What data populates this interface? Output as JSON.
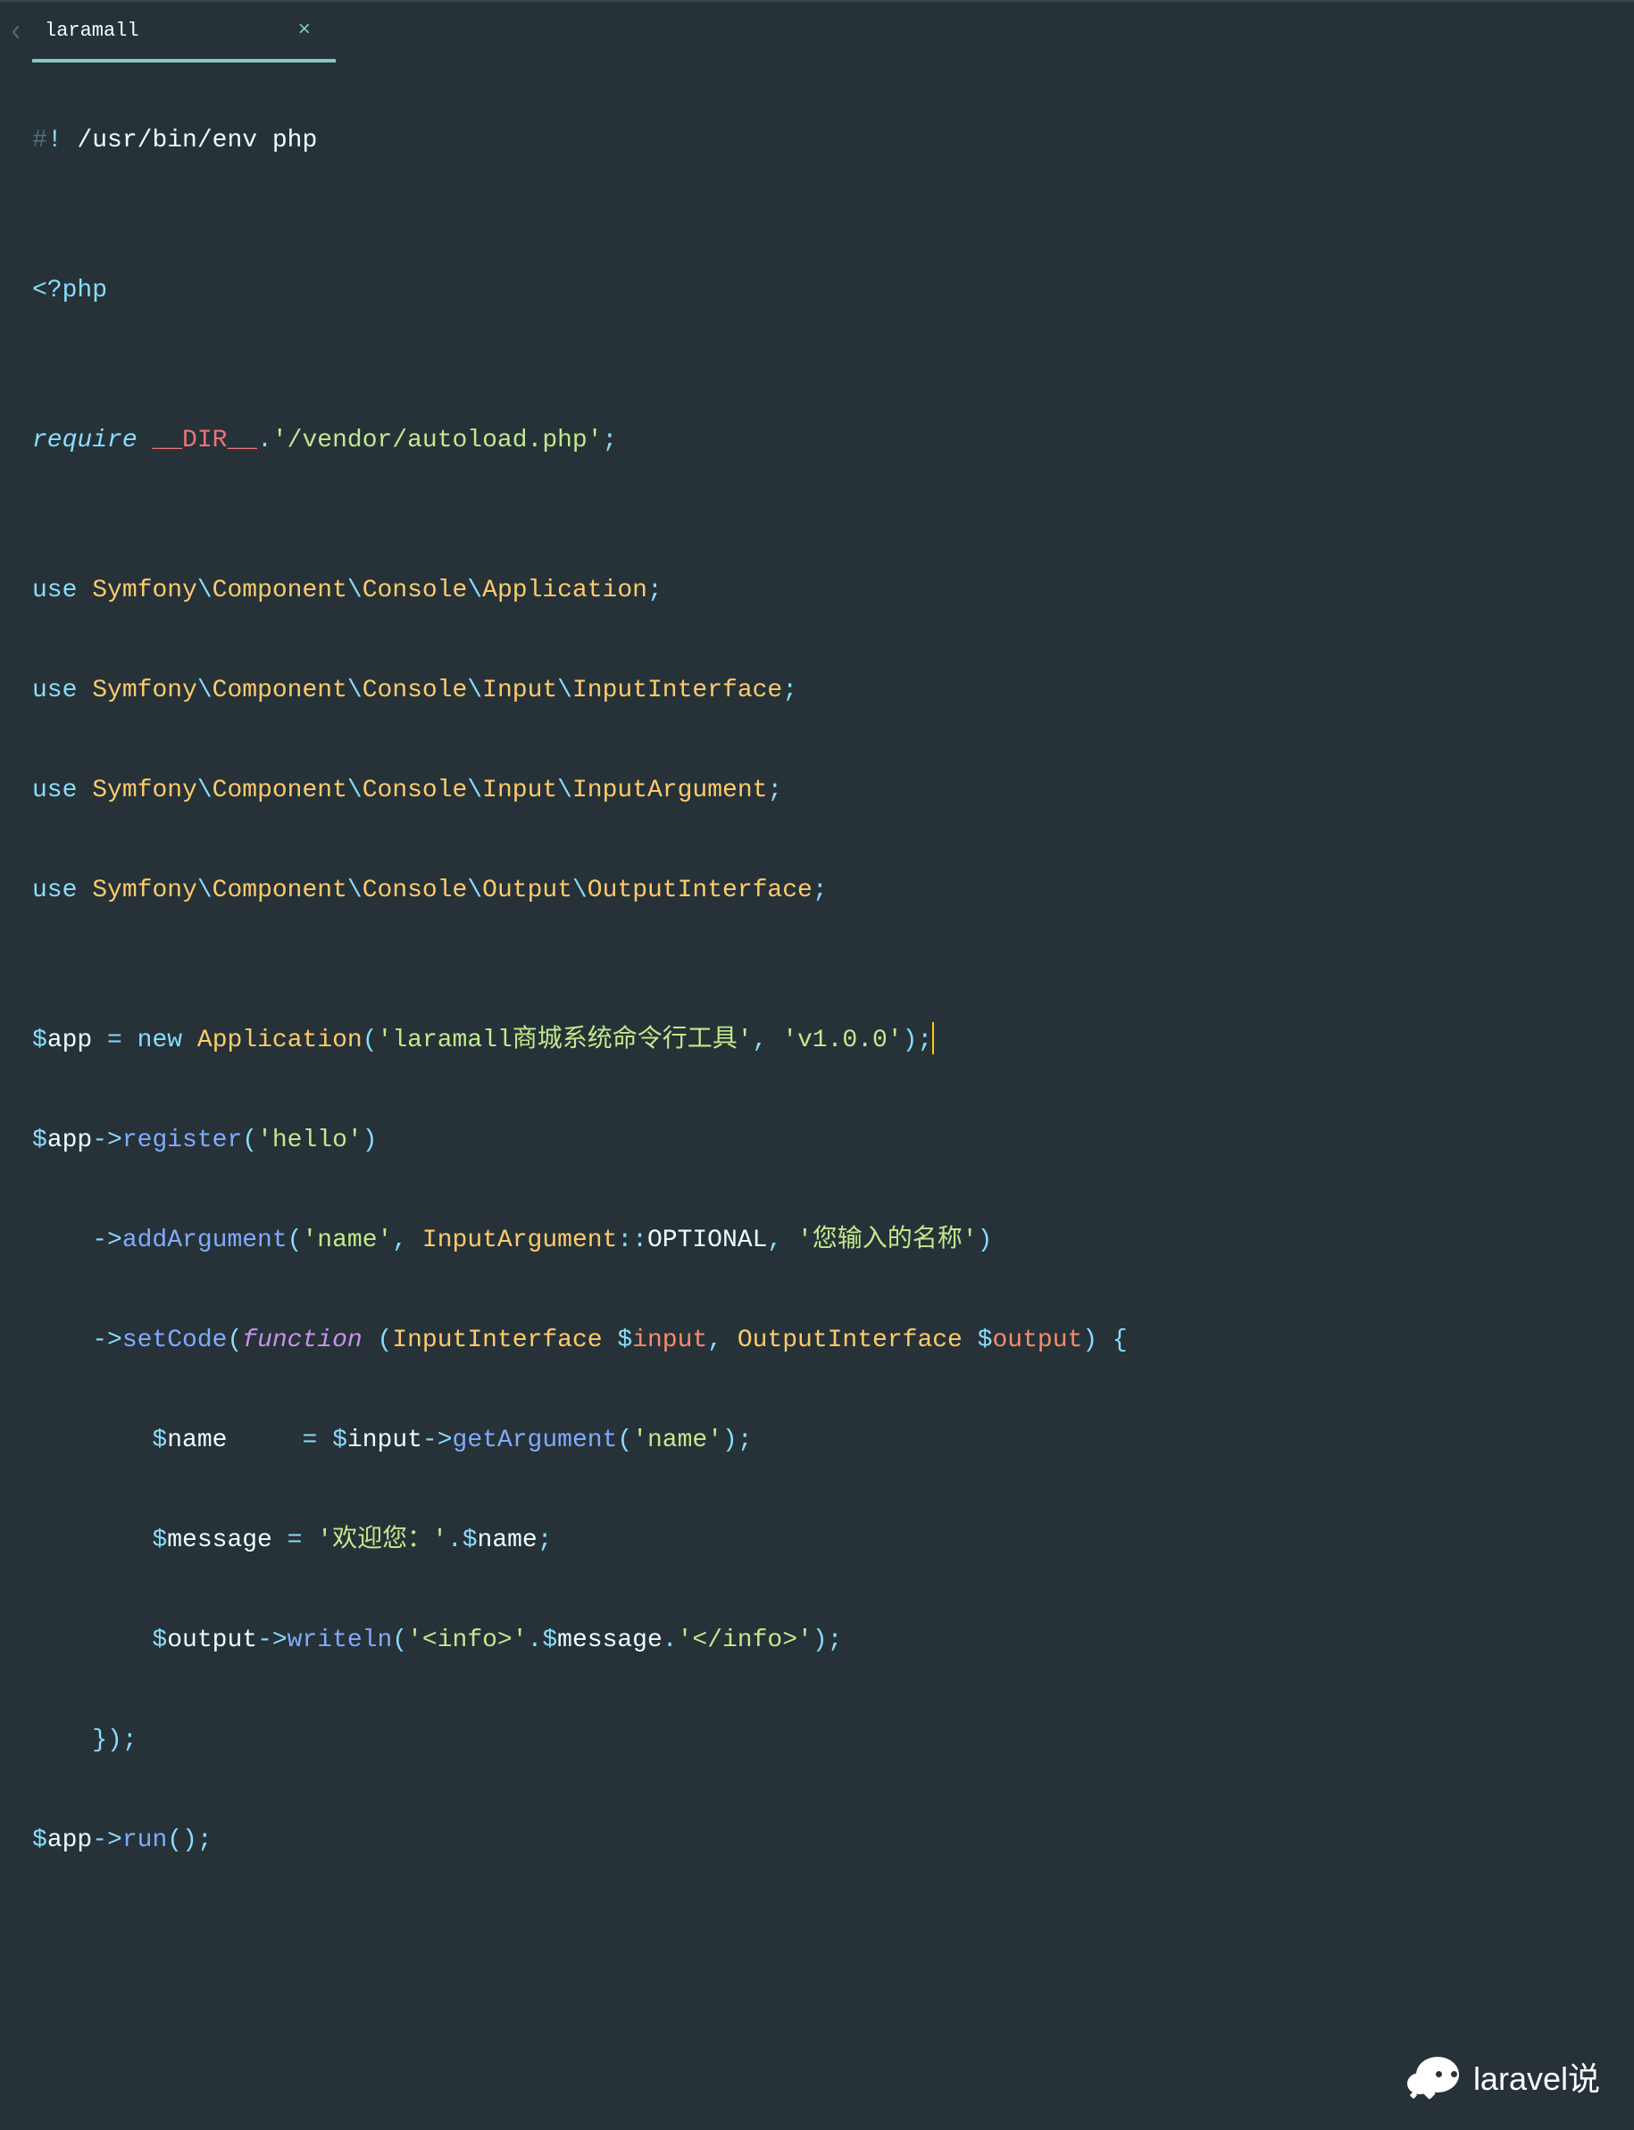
{
  "tab": {
    "label": "laramall",
    "close_glyph": "×"
  },
  "code": {
    "l1_shebang_prefix": "#",
    "l1_shebang_bang": "!",
    "l1_shebang_path": " /usr/bin/env php",
    "l3_php_open_lt": "<?",
    "l3_php_open_kw": "php",
    "l5_require": "require",
    "l5_dir": "__DIR__",
    "l5_dot": ".",
    "l5_path": "'/vendor/autoload.php'",
    "l5_semi": ";",
    "use_kw": "use",
    "ns_sep": "\\",
    "ns_symfony": "Symfony",
    "ns_component": "Component",
    "ns_console": "Console",
    "ns_input": "Input",
    "ns_output": "Output",
    "cls_application": "Application",
    "cls_inputinterface": "InputInterface",
    "cls_inputargument": "InputArgument",
    "cls_outputinterface": "OutputInterface",
    "semi": ";",
    "dollar": "$",
    "var_app": "app",
    "eq": " = ",
    "new_kw": "new",
    "app_name_str": "'laramall商城系统命令行工具'",
    "comma": ", ",
    "app_ver_str": "'v1.0.0'",
    "lparen": "(",
    "rparen": ")",
    "arrow": "->",
    "m_register": "register",
    "hello_str": "'hello'",
    "m_addargument": "addArgument",
    "name_str": "'name'",
    "scope": "::",
    "const_optional": "OPTIONAL",
    "desc_str": "'您输入的名称'",
    "m_setcode": "setCode",
    "function_kw": "function",
    "var_input": "input",
    "var_output": "output",
    "lbrace": " {",
    "var_name": "name",
    "pad_name": "    ",
    "m_getargument": "getArgument",
    "var_message": "message",
    "welcome_str": "'欢迎您：'",
    "concat_dot": ".",
    "m_writeln": "writeln",
    "info_open_str": "'<info>'",
    "info_close_str": "'</info>'",
    "rbrace_line": "    });",
    "m_run": "run",
    "empty_parens": "()"
  },
  "watermark": {
    "text": "laravel说"
  }
}
